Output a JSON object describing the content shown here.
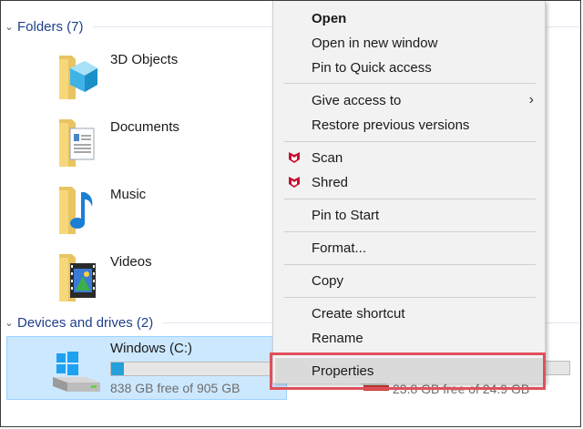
{
  "explorer": {
    "folders_group": {
      "title": "Folders (7)",
      "expanded": true
    },
    "folders": [
      {
        "name": "3D Objects",
        "icon": "3d-objects-folder-icon"
      },
      {
        "name": "Documents",
        "icon": "documents-folder-icon"
      },
      {
        "name": "Music",
        "icon": "music-folder-icon"
      },
      {
        "name": "Videos",
        "icon": "videos-folder-icon"
      }
    ],
    "devices_group": {
      "title": "Devices and drives (2)",
      "expanded": true
    },
    "drive": {
      "name": "Windows (C:)",
      "free_text": "838 GB free of 905 GB",
      "used_fraction": 0.074,
      "selected": true
    },
    "drive2": {
      "free_text": "23.8 GB free of 24.9 GB",
      "used_fraction": 0.044
    }
  },
  "context_menu": {
    "items": [
      {
        "label": "Open",
        "bold": true
      },
      {
        "label": "Open in new window"
      },
      {
        "label": "Pin to Quick access"
      },
      {
        "label": "Give access to",
        "submenu": true
      },
      {
        "label": "Restore previous versions"
      },
      {
        "label": "Scan",
        "icon": "mcafee-icon"
      },
      {
        "label": "Shred",
        "icon": "mcafee-icon"
      },
      {
        "label": "Pin to Start"
      },
      {
        "label": "Format..."
      },
      {
        "label": "Copy"
      },
      {
        "label": "Create shortcut"
      },
      {
        "label": "Rename"
      },
      {
        "label": "Properties",
        "highlighted": true
      }
    ]
  },
  "colors": {
    "group_title": "#1e3f8a",
    "selection_bg": "#cce8ff",
    "progress_fill": "#26a0da",
    "menu_bg": "#f2f2f2",
    "highlight_outline": "#e0505c",
    "mcafee_red": "#c8102e"
  }
}
